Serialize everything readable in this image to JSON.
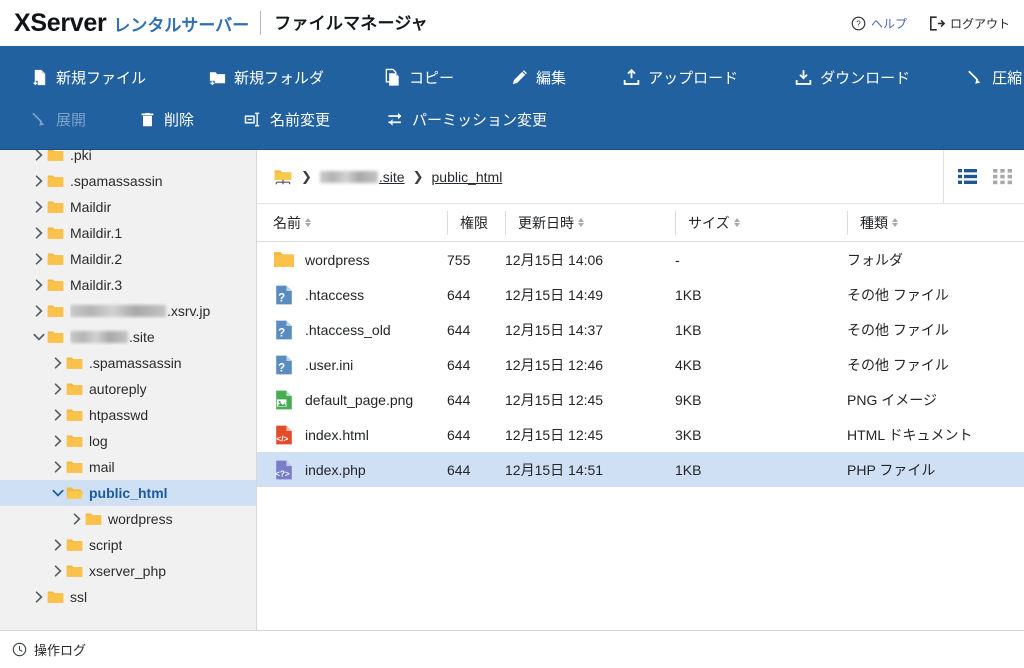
{
  "header": {
    "brand_main": "XServer",
    "brand_sub": "レンタルサーバー",
    "app_title": "ファイルマネージャ",
    "help_label": "ヘルプ",
    "logout_label": "ログアウト",
    "help_icon": "question-circle-icon",
    "logout_icon": "logout-arrow-icon",
    "accent_blue": "#2f6fb5"
  },
  "toolbar": {
    "background": "#22619f",
    "row1": [
      {
        "label": "新規ファイル",
        "icon": "new-file-icon",
        "disabled": false
      },
      {
        "label": "新規フォルダ",
        "icon": "new-folder-icon",
        "disabled": false
      },
      {
        "label": "コピー",
        "icon": "copy-icon",
        "disabled": false
      },
      {
        "label": "編集",
        "icon": "pencil-icon",
        "disabled": false
      },
      {
        "label": "アップロード",
        "icon": "upload-icon",
        "disabled": false
      },
      {
        "label": "ダウンロード",
        "icon": "download-icon",
        "disabled": false
      },
      {
        "label": "圧縮",
        "icon": "compress-icon",
        "disabled": false
      }
    ],
    "row2": [
      {
        "label": "展開",
        "icon": "expand-icon",
        "disabled": true
      },
      {
        "label": "削除",
        "icon": "trash-icon",
        "disabled": false
      },
      {
        "label": "名前変更",
        "icon": "rename-icon",
        "disabled": false
      },
      {
        "label": "パーミッション変更",
        "icon": "permission-icon",
        "disabled": false
      }
    ]
  },
  "sidebar": {
    "background": "#f1f1f1",
    "selected_background": "#cfe0f4",
    "items": [
      {
        "label": ".pki",
        "indent": 1,
        "expanded": false,
        "selected": false,
        "redacted": 0
      },
      {
        "label": ".spamassassin",
        "indent": 1,
        "expanded": false,
        "selected": false,
        "redacted": 0
      },
      {
        "label": "Maildir",
        "indent": 1,
        "expanded": false,
        "selected": false,
        "redacted": 0
      },
      {
        "label": "Maildir.1",
        "indent": 1,
        "expanded": false,
        "selected": false,
        "redacted": 0
      },
      {
        "label": "Maildir.2",
        "indent": 1,
        "expanded": false,
        "selected": false,
        "redacted": 0
      },
      {
        "label": "Maildir.3",
        "indent": 1,
        "expanded": false,
        "selected": false,
        "redacted": 0
      },
      {
        "label": ".xsrv.jp",
        "indent": 1,
        "expanded": false,
        "selected": false,
        "redacted": 96
      },
      {
        "label": ".site",
        "indent": 1,
        "expanded": true,
        "selected": false,
        "redacted": 58
      },
      {
        "label": ".spamassassin",
        "indent": 2,
        "expanded": false,
        "selected": false,
        "redacted": 0
      },
      {
        "label": "autoreply",
        "indent": 2,
        "expanded": false,
        "selected": false,
        "redacted": 0
      },
      {
        "label": "htpasswd",
        "indent": 2,
        "expanded": false,
        "selected": false,
        "redacted": 0
      },
      {
        "label": "log",
        "indent": 2,
        "expanded": false,
        "selected": false,
        "redacted": 0
      },
      {
        "label": "mail",
        "indent": 2,
        "expanded": false,
        "selected": false,
        "redacted": 0
      },
      {
        "label": "public_html",
        "indent": 2,
        "expanded": true,
        "selected": true,
        "redacted": 0
      },
      {
        "label": "wordpress",
        "indent": 3,
        "expanded": false,
        "selected": false,
        "redacted": 0
      },
      {
        "label": "script",
        "indent": 2,
        "expanded": false,
        "selected": false,
        "redacted": 0
      },
      {
        "label": "xserver_php",
        "indent": 2,
        "expanded": false,
        "selected": false,
        "redacted": 0
      },
      {
        "label": "ssl",
        "indent": 1,
        "expanded": false,
        "selected": false,
        "redacted": 0
      }
    ]
  },
  "breadcrumb": {
    "root_icon": "server-folder-icon",
    "separator": "❯",
    "items": [
      {
        "label": ".site",
        "redacted": 58
      },
      {
        "label": "public_html",
        "redacted": 0
      }
    ]
  },
  "view_toggle": {
    "list_view": {
      "icon": "list-view-icon",
      "active": true,
      "color": "#1f5795"
    },
    "grid_view": {
      "icon": "grid-view-icon",
      "active": false,
      "color": "#a5a8ad"
    }
  },
  "table": {
    "columns": [
      {
        "key": "name",
        "label": "名前",
        "sortable": true
      },
      {
        "key": "perm",
        "label": "権限",
        "sortable": false
      },
      {
        "key": "date",
        "label": "更新日時",
        "sortable": true
      },
      {
        "key": "size",
        "label": "サイズ",
        "sortable": true
      },
      {
        "key": "type",
        "label": "種類",
        "sortable": true
      }
    ],
    "rows": [
      {
        "name": "wordpress",
        "perm": "755",
        "date": "12月15日 14:06",
        "size": "-",
        "type": "フォルダ",
        "icon": "folder-icon",
        "selected": false
      },
      {
        "name": ".htaccess",
        "perm": "644",
        "date": "12月15日 14:49",
        "size": "1KB",
        "type": "その他 ファイル",
        "icon": "unknown-file-icon",
        "selected": false
      },
      {
        "name": ".htaccess_old",
        "perm": "644",
        "date": "12月15日 14:37",
        "size": "1KB",
        "type": "その他 ファイル",
        "icon": "unknown-file-icon",
        "selected": false
      },
      {
        "name": ".user.ini",
        "perm": "644",
        "date": "12月15日 12:46",
        "size": "4KB",
        "type": "その他 ファイル",
        "icon": "unknown-file-icon",
        "selected": false
      },
      {
        "name": "default_page.png",
        "perm": "644",
        "date": "12月15日 12:45",
        "size": "9KB",
        "type": "PNG イメージ",
        "icon": "image-file-icon",
        "selected": false
      },
      {
        "name": "index.html",
        "perm": "644",
        "date": "12月15日 12:45",
        "size": "3KB",
        "type": "HTML ドキュメント",
        "icon": "html-file-icon",
        "selected": false
      },
      {
        "name": "index.php",
        "perm": "644",
        "date": "12月15日 14:51",
        "size": "1KB",
        "type": "PHP ファイル",
        "icon": "php-file-icon",
        "selected": true
      }
    ]
  },
  "footer": {
    "log_label": "操作ログ",
    "log_icon": "clock-icon"
  }
}
